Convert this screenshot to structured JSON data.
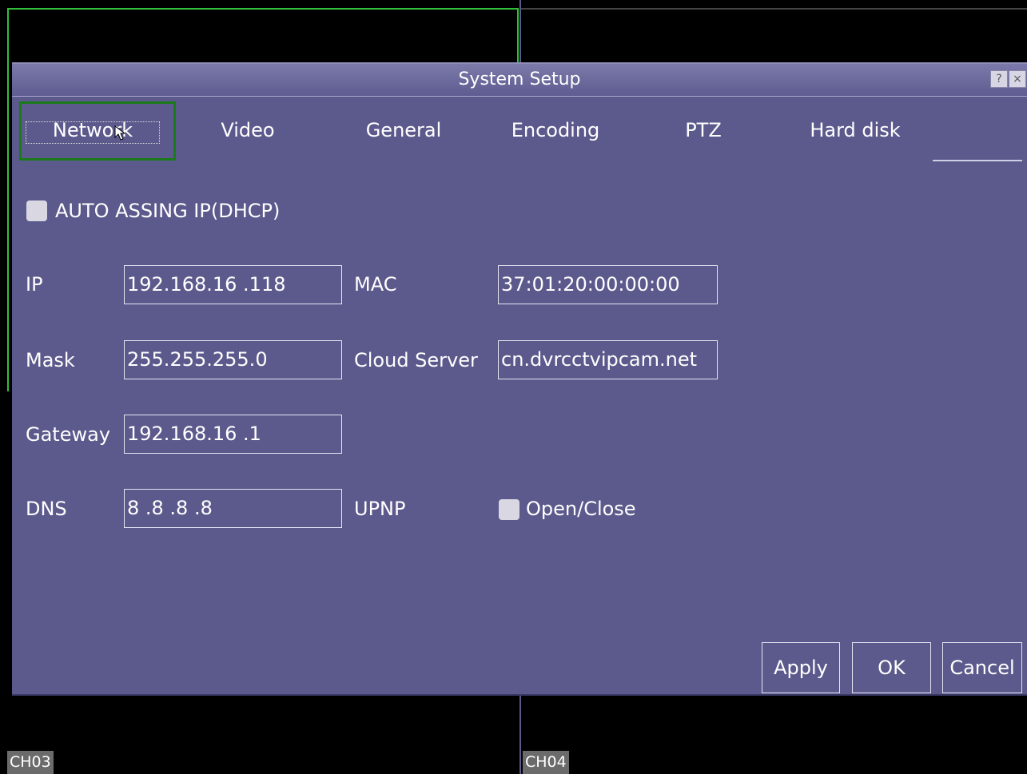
{
  "background": {
    "channels": [
      "CH03",
      "CH04"
    ]
  },
  "dialog": {
    "title": "System Setup",
    "help_label": "?",
    "close_label": "×",
    "tabs": [
      "Network",
      "Video",
      "General",
      "Encoding",
      "PTZ",
      "Hard disk"
    ],
    "active_tab": "Network",
    "dhcp_label": "AUTO ASSING IP(DHCP)",
    "dhcp_checked": false,
    "fields": {
      "ip": {
        "label": "IP",
        "value": "192.168.16 .118"
      },
      "mask": {
        "label": "Mask",
        "value": "255.255.255.0"
      },
      "gateway": {
        "label": "Gateway",
        "value": "192.168.16 .1"
      },
      "dns": {
        "label": "DNS",
        "value": "8  .8  .8  .8"
      },
      "mac": {
        "label": "MAC",
        "value": "37:01:20:00:00:00"
      },
      "cloud": {
        "label": "Cloud Server",
        "value": "cn.dvrcctvipcam.net"
      }
    },
    "upnp": {
      "label": "UPNP",
      "toggle_label": "Open/Close",
      "checked": false
    },
    "buttons": {
      "apply": "Apply",
      "ok": "OK",
      "cancel": "Cancel"
    }
  },
  "colors": {
    "dialog_bg": "#5c5a8c",
    "focus_outline": "#1a7a1a",
    "channel_outline": "#2fbf3a"
  }
}
